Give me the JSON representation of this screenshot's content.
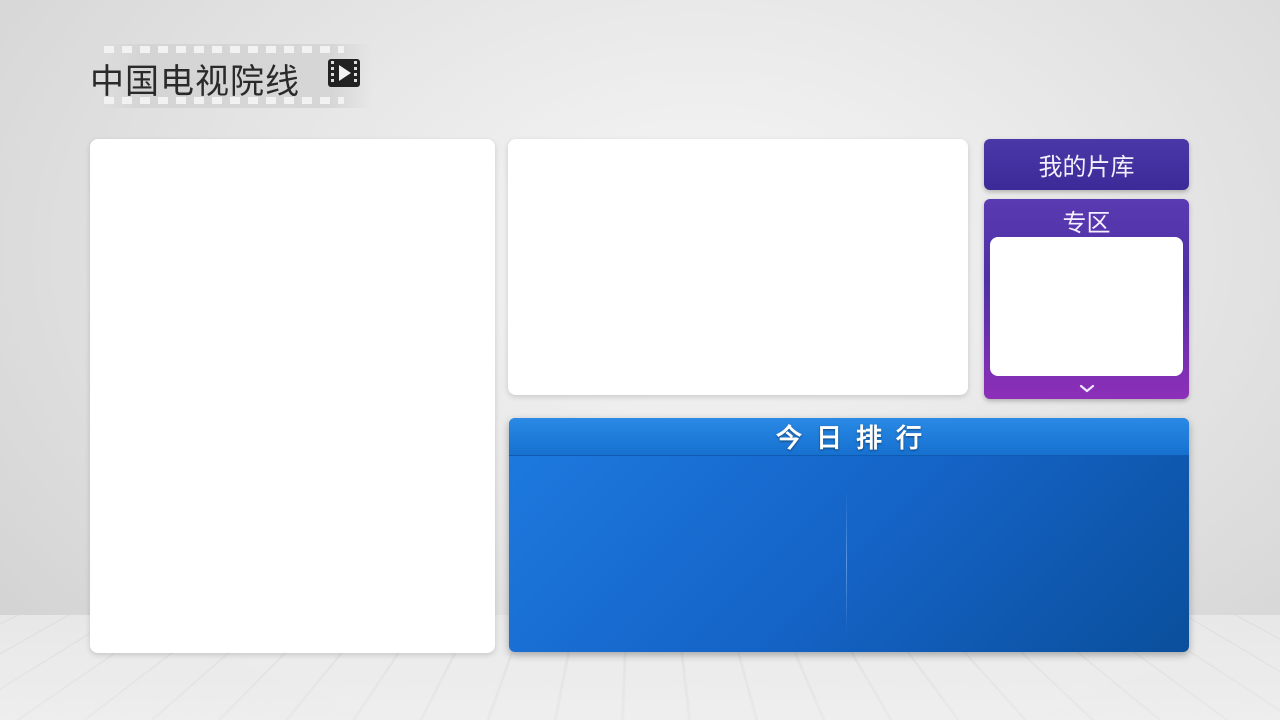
{
  "logo": {
    "title": "中国电视院线",
    "icon": "film-play-icon"
  },
  "tiles": {
    "my_library_label": "我的片库",
    "zone_label": "专区",
    "zone_chevron_icon": "chevron-down-icon",
    "ranking_label": "今日排行"
  },
  "colors": {
    "library_bg": "#4a38a8",
    "zone_top": "#5a3ab0",
    "zone_bottom": "#8d2fb8",
    "ranking_bg": "#1564c8"
  }
}
